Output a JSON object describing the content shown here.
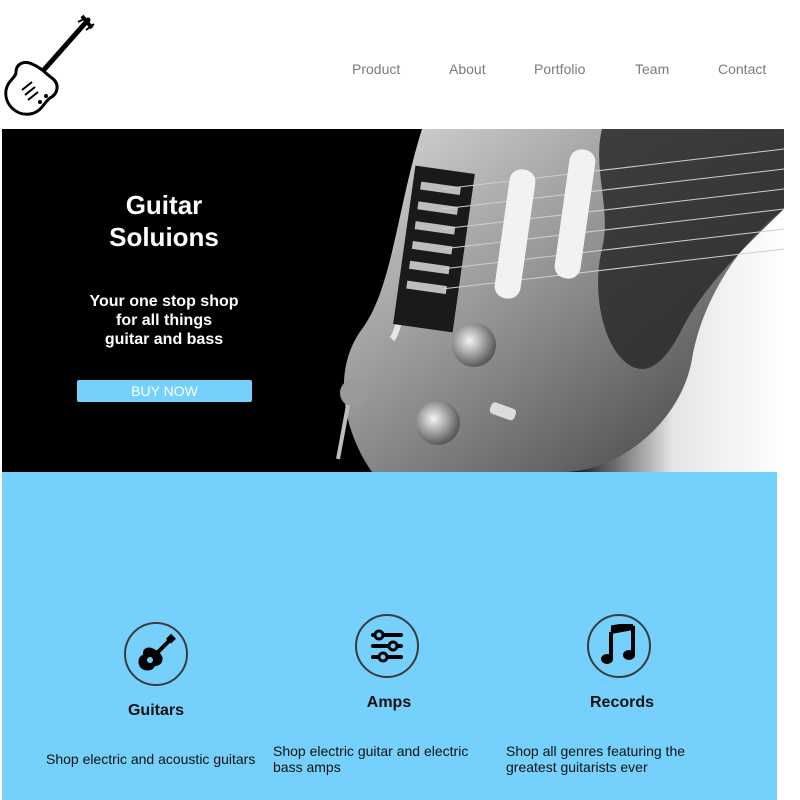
{
  "nav": {
    "items": [
      {
        "label": "Product"
      },
      {
        "label": "About"
      },
      {
        "label": "Portfolio"
      },
      {
        "label": "Team"
      },
      {
        "label": "Contact"
      }
    ]
  },
  "hero": {
    "title_line1": "Guitar",
    "title_line2": "Soluions",
    "subtitle_line1": "Your one stop shop",
    "subtitle_line2": "for all things",
    "subtitle_line3": "guitar and bass",
    "cta_label": "BUY NOW"
  },
  "features": [
    {
      "title": "Guitars",
      "icon": "guitar-icon",
      "description": "Shop electric and acoustic guitars"
    },
    {
      "title": "Amps",
      "icon": "sliders-icon",
      "description": "Shop electric guitar and electric bass amps"
    },
    {
      "title": "Records",
      "icon": "music-note-icon",
      "description": "Shop all genres featuring the greatest guitarists ever"
    }
  ],
  "colors": {
    "accent": "#75d1fc",
    "hero_background": "#000000",
    "nav_text": "#7a7a7a"
  }
}
